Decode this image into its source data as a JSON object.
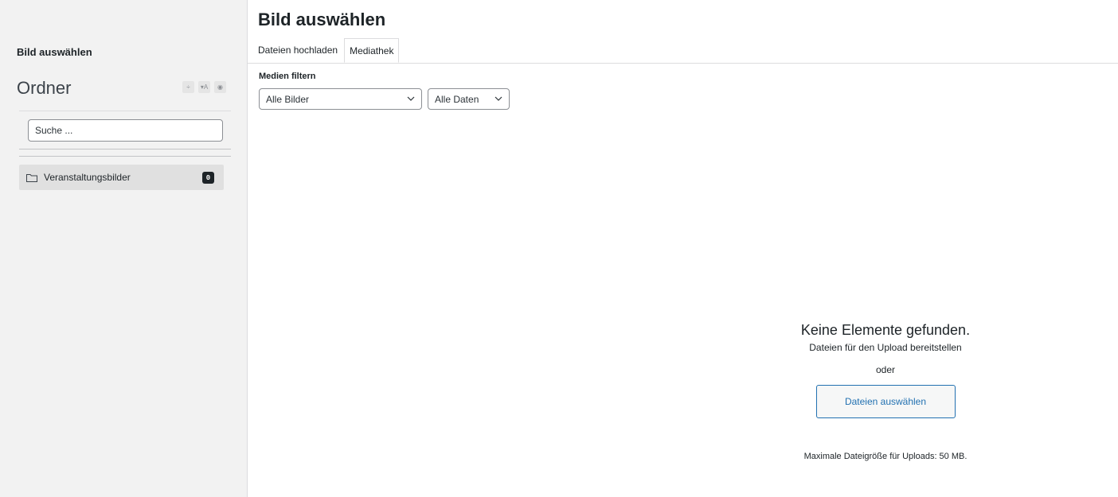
{
  "sidebar": {
    "title": "Bild auswählen",
    "folder_heading": "Ordner",
    "tools": [
      {
        "icon": "sort-icon",
        "glyph": "÷"
      },
      {
        "icon": "filter-icon",
        "glyph": "▾A"
      },
      {
        "icon": "eye-icon",
        "glyph": "◉"
      }
    ],
    "search_placeholder": "Suche ...",
    "folders": [
      {
        "label": "Veranstaltungsbilder",
        "count": "0"
      }
    ]
  },
  "main": {
    "title": "Bild auswählen",
    "tabs": [
      {
        "label": "Dateien hochladen",
        "active": false
      },
      {
        "label": "Mediathek",
        "active": true
      }
    ],
    "filter_label": "Medien filtern",
    "type_filter": "Alle Bilder",
    "date_filter": "Alle Daten",
    "empty": {
      "title": "Keine Elemente gefunden.",
      "subtitle": "Dateien für den Upload bereitstellen",
      "or": "oder",
      "button": "Dateien auswählen",
      "max_size": "Maximale Dateigröße für Uploads: 50 MB."
    }
  },
  "colors": {
    "accent": "#2271b1",
    "sidebar_bg": "#f2f2f2",
    "badge_bg": "#1d2327"
  }
}
